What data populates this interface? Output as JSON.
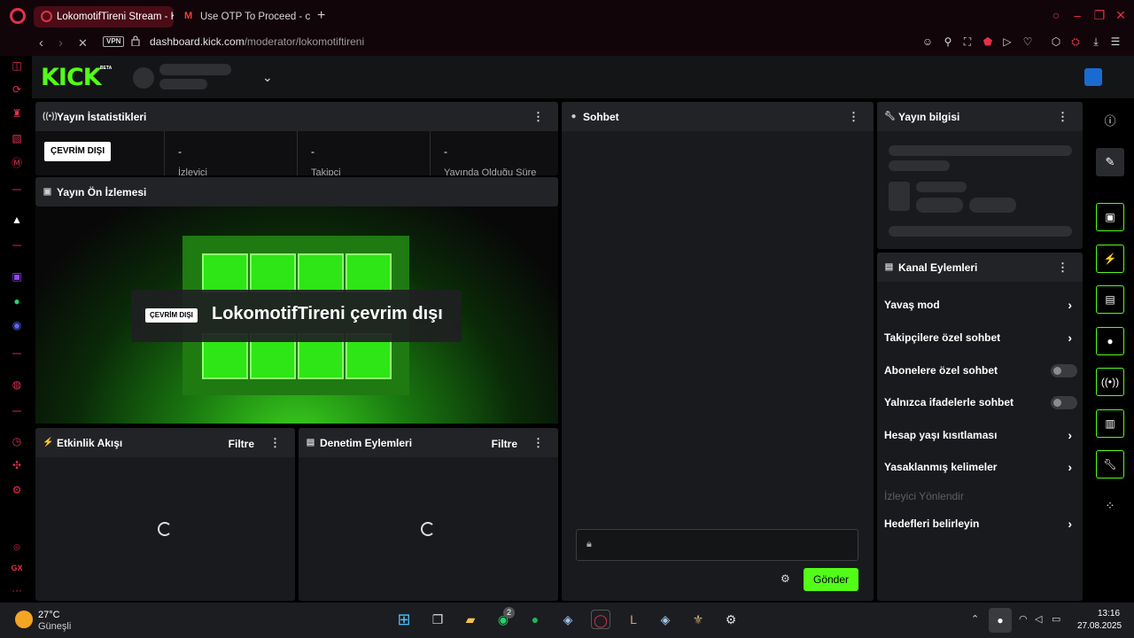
{
  "browser": {
    "tabs": [
      {
        "title": "LokomotifTireni Stream - K"
      },
      {
        "title": "Use OTP To Proceed - cim"
      }
    ],
    "vpn_label": "VPN",
    "url_domain": "dashboard.kick.com",
    "url_path": "/moderator/lokomotiftireni",
    "accent": "#e2304c"
  },
  "kick": {
    "logo": "KICK",
    "beta": "BETA",
    "brand_color": "#53fc18"
  },
  "stats_panel": {
    "title": "Yayın İstatistikleri",
    "status_badge": "ÇEVRİM DIŞI",
    "cells": [
      {
        "value": "-",
        "label": "İzleyici"
      },
      {
        "value": "-",
        "label": "Takipçi"
      },
      {
        "value": "-",
        "label": "Yayında Olduğu Süre"
      }
    ]
  },
  "preview_panel": {
    "title": "Yayın Ön İzlemesi",
    "offline_badge": "ÇEVRİM DIŞI",
    "offline_text": "LokomotifTireni çevrim dışı"
  },
  "activity_panel": {
    "title": "Etkinlik Akışı",
    "filter": "Filtre"
  },
  "moderation_panel": {
    "title": "Denetim Eylemleri",
    "filter": "Filtre"
  },
  "chat_panel": {
    "title": "Sohbet",
    "send": "Gönder"
  },
  "stream_info_panel": {
    "title": "Yayın bilgisi"
  },
  "channel_actions_panel": {
    "title": "Kanal Eylemleri",
    "rows": [
      {
        "label": "Yavaş mod",
        "control": "arrow"
      },
      {
        "label": "Takipçilere özel sohbet",
        "control": "arrow"
      },
      {
        "label": "Abonelere özel sohbet",
        "control": "toggle"
      },
      {
        "label": "Yalnızca ifadelerle sohbet",
        "control": "toggle"
      },
      {
        "label": "Hesap yaşı kısıtlaması",
        "control": "arrow"
      },
      {
        "label": "Yasaklanmış kelimeler",
        "control": "arrow"
      }
    ],
    "section_label": "İzleyici Yönlendir",
    "targets_row": "Hedefleri belirleyin"
  },
  "taskbar": {
    "temperature": "27°C",
    "weather": "Güneşli",
    "time": "13:16",
    "date": "27.08.2025",
    "whatsapp_badge": "2"
  }
}
